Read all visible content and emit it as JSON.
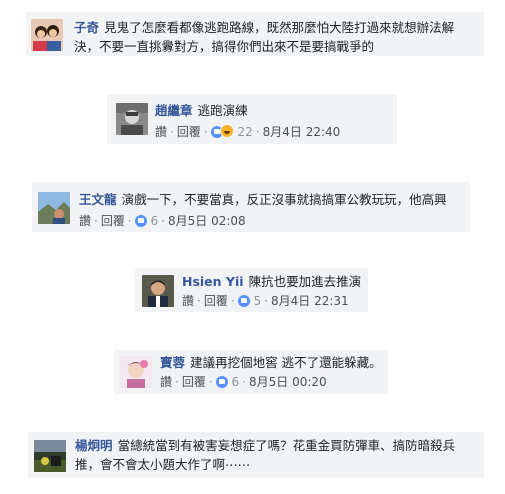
{
  "comments": [
    {
      "author": "子奇",
      "lines": [
        "見鬼了怎麼看都像逃跑路線，既然那麼怕大陸打過來就想辦法解",
        "決，不要一直挑釁對方，搞得你們出來不是要搞戰爭的"
      ]
    },
    {
      "author": "趙繼章",
      "text": "逃跑演練",
      "like": "讚",
      "reply": "回覆",
      "reactions": "22",
      "time": "8月4日 22:40"
    },
    {
      "author": "王文龍",
      "text": "演戲一下，不要當真，反正沒事就搞搞軍公教玩玩，他高興",
      "like": "讚",
      "reply": "回覆",
      "reactions": "6",
      "time": "8月5日 02:08"
    },
    {
      "author": "Hsien Yii",
      "text": "陳抗也要加進去推演",
      "like": "讚",
      "reply": "回覆",
      "reactions": "5",
      "time": "8月4日 22:31"
    },
    {
      "author": "寶蓉",
      "text": "建議再挖個地窖 逃不了還能躲藏。",
      "like": "讚",
      "reply": "回覆",
      "reactions": "6",
      "time": "8月5日 00:20"
    },
    {
      "author": "楊炯明",
      "lines": [
        "當總統當到有被害妄想症了嗎？花重金買防彈車、搞防暗殺兵",
        "推，會不會太小題大作了啊⋯⋯"
      ]
    }
  ],
  "icons": {
    "like": "like-icon",
    "haha": "haha-icon"
  },
  "colors": {
    "name": "#365899",
    "card": "#f2f3f5",
    "like_blue": "#5890ff"
  }
}
